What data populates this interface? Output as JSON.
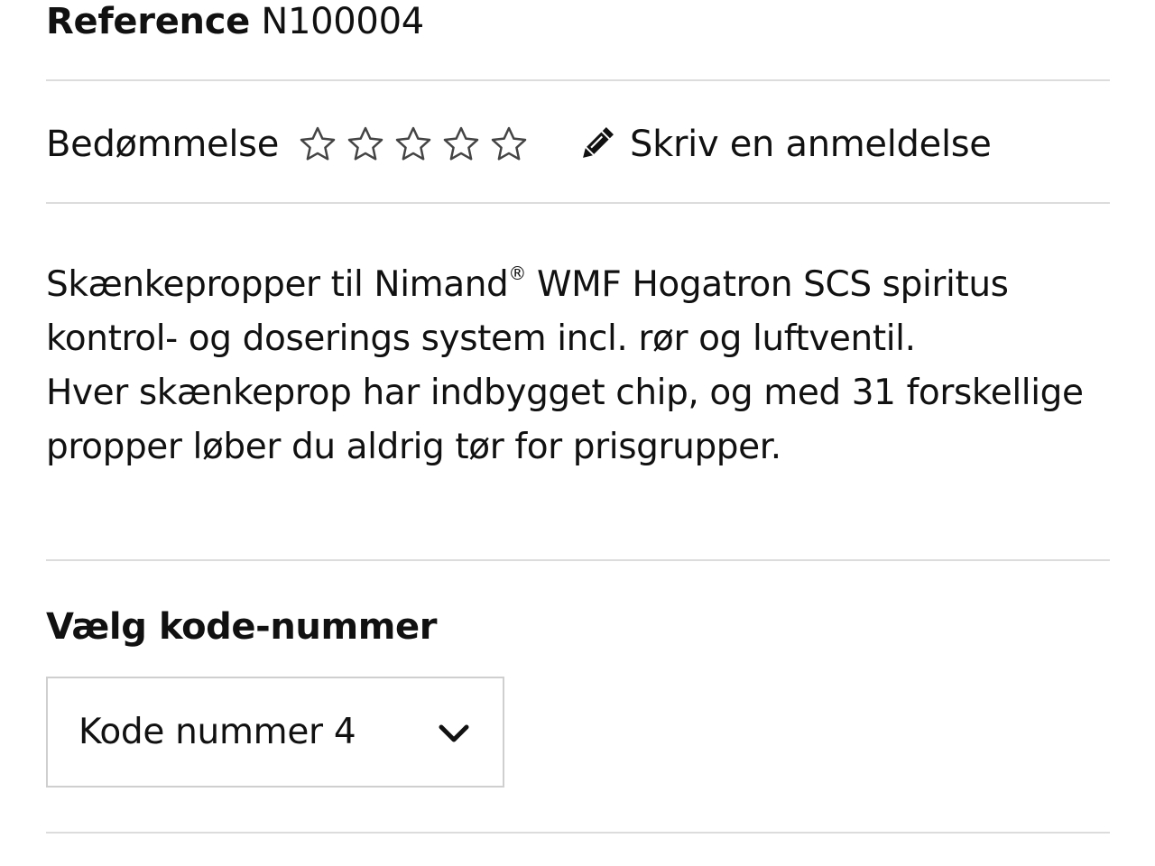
{
  "reference": {
    "label": "Reference",
    "value": "N100004"
  },
  "rating": {
    "label": "Bedømmelse",
    "stars_filled": 0,
    "stars_total": 5,
    "write_review_label": "Skriv en anmeldelse",
    "write_review_icon": "pencil-icon",
    "star_icon": "star-outline-icon"
  },
  "description": {
    "line1_before_mark": "Skænkepropper til Nimand",
    "registered_mark": "®",
    "line1_after_mark": " WMF Hogatron SCS spiritus kontrol- og doserings system incl. rør og luftventil.",
    "paragraph2": "Hver skænkeprop har indbygget chip, og med 31 forskellige propper løber du aldrig tør for prisgrupper."
  },
  "code_select": {
    "label": "Vælg kode-nummer",
    "selected": "Kode nummer 4",
    "icon": "chevron-down-icon"
  },
  "colors": {
    "text": "#111111",
    "divider": "#dcdcdc",
    "select_border": "#cfcfcf"
  }
}
